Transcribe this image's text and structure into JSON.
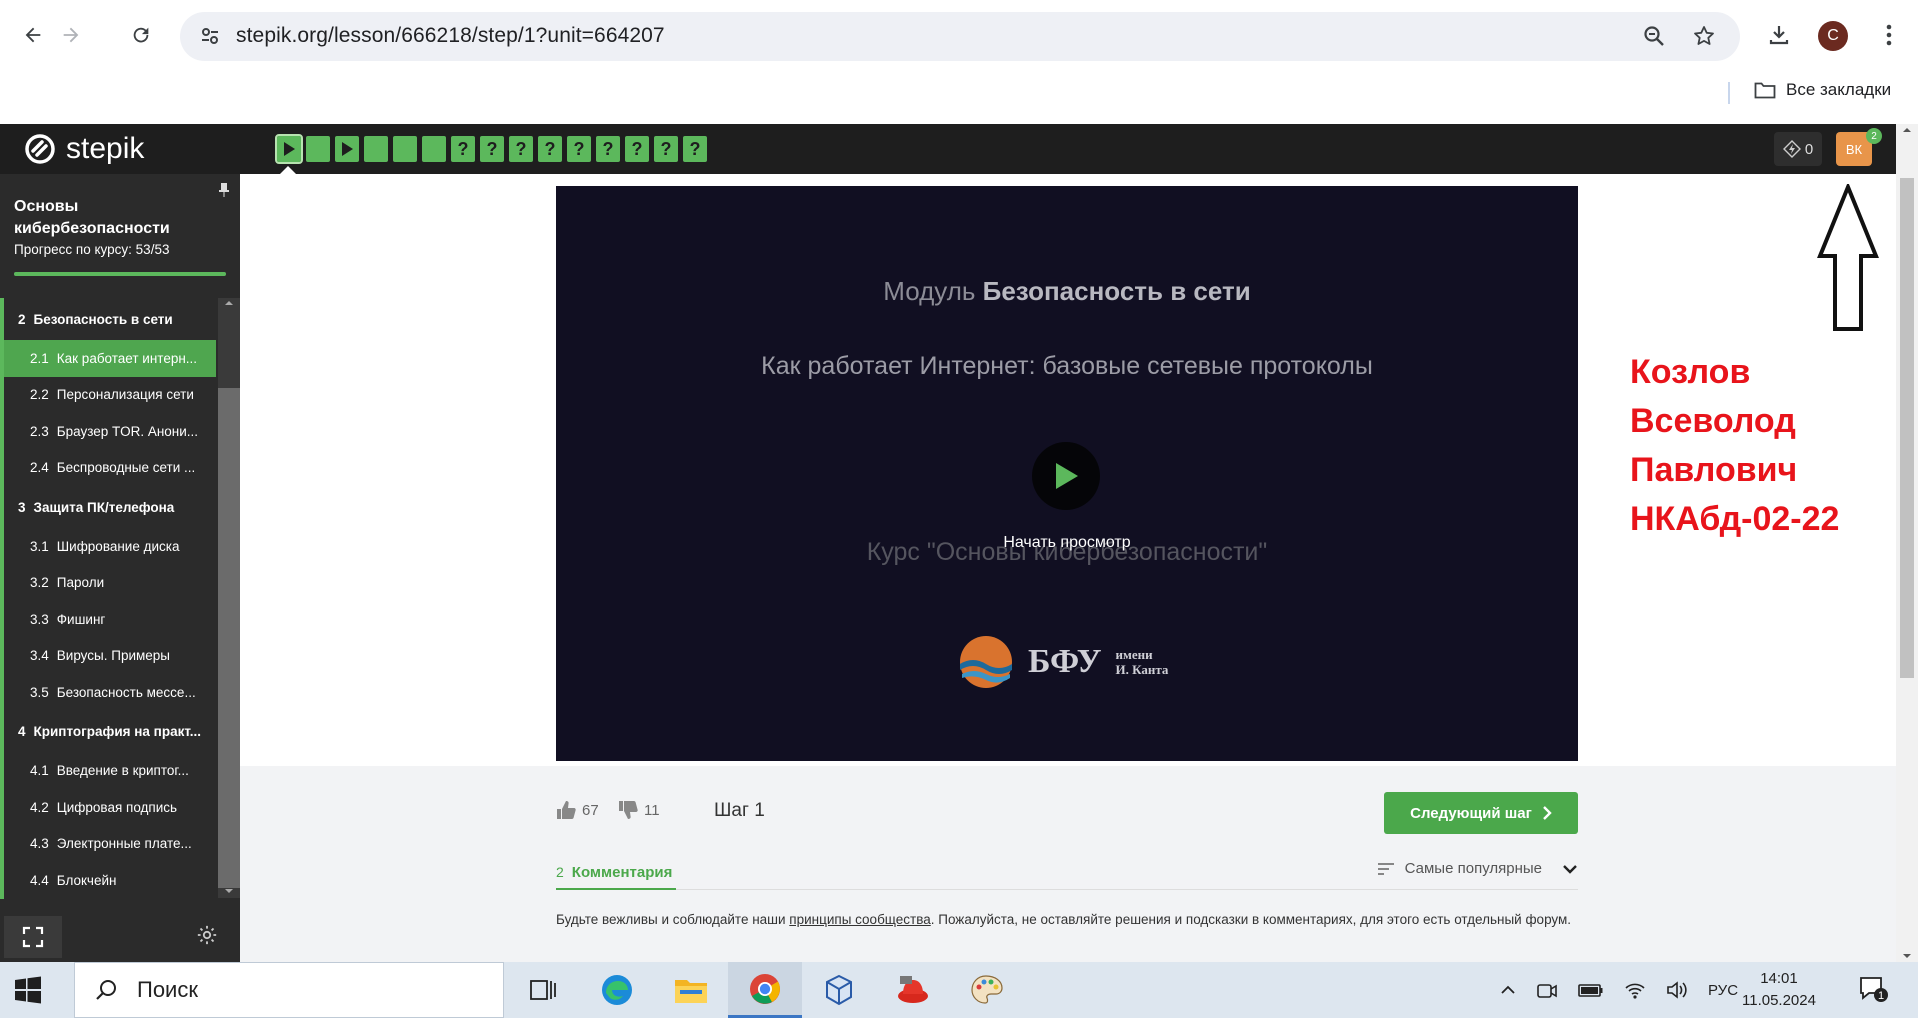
{
  "browser": {
    "url": "stepik.org/lesson/666218/step/1?unit=664207",
    "profile_initial": "C",
    "bookmarks_label": "Все закладки"
  },
  "header": {
    "logo_text": "stepik",
    "steps": [
      "video",
      "done",
      "video",
      "done",
      "done",
      "done",
      "?",
      "?",
      "?",
      "?",
      "?",
      "?",
      "?",
      "?",
      "?"
    ],
    "energy": "0",
    "user_initials": "ВК",
    "notifications": "2"
  },
  "sidebar": {
    "course_title": "Основы кибербезопасности",
    "progress_label": "Прогресс по курсу:",
    "progress_value": "53/53",
    "progress_fraction": 1.0,
    "sections": [
      {
        "num": "2",
        "title": "Безопасность в сети",
        "lessons": [
          {
            "num": "2.1",
            "title": "Как работает интерн...",
            "active": true
          },
          {
            "num": "2.2",
            "title": "Персонализация сети"
          },
          {
            "num": "2.3",
            "title": "Браузер TOR. Анони..."
          },
          {
            "num": "2.4",
            "title": "Беспроводные сети ..."
          }
        ]
      },
      {
        "num": "3",
        "title": "Защита ПК/телефона",
        "lessons": [
          {
            "num": "3.1",
            "title": "Шифрование диска"
          },
          {
            "num": "3.2",
            "title": "Пароли"
          },
          {
            "num": "3.3",
            "title": "Фишинг"
          },
          {
            "num": "3.4",
            "title": "Вирусы. Примеры"
          },
          {
            "num": "3.5",
            "title": "Безопасность мессе..."
          }
        ]
      },
      {
        "num": "4",
        "title": "Криптография на практ...",
        "lessons": [
          {
            "num": "4.1",
            "title": "Введение в криптог..."
          },
          {
            "num": "4.2",
            "title": "Цифровая подпись"
          },
          {
            "num": "4.3",
            "title": "Электронные плате..."
          },
          {
            "num": "4.4",
            "title": "Блокчейн"
          }
        ]
      }
    ]
  },
  "video": {
    "module_prefix": "Модуль",
    "module_name": "Безопасность в сети",
    "lesson_title": "Как работает Интернет: базовые сетевые протоколы",
    "start_label": "Начать просмотр",
    "course_line": "Курс \"Основы кибербезопасности\"",
    "logo_big": "БФУ",
    "logo_small_1": "имени",
    "logo_small_2": "И. Канта"
  },
  "step": {
    "likes": "67",
    "dislikes": "11",
    "step_label": "Шаг 1",
    "next_label": "Следующий шаг"
  },
  "comments": {
    "count": "2",
    "tab_label": "Комментария",
    "sort_label": "Самые популярные",
    "rules_before": "Будьте вежливы и соблюдайте наши ",
    "rules_link": "принципы сообщества",
    "rules_after": ". Пожалуйста, не оставляйте решения и подсказки в комментариях, для этого есть отдельный форум."
  },
  "annotation": {
    "name_lines": [
      "Козлов",
      "Всеволод",
      "Павлович",
      "НКАбд-02-22"
    ],
    "color": "#e8141b"
  },
  "taskbar": {
    "search_placeholder": "Поиск",
    "language": "РУС",
    "time": "14:01",
    "date": "11.05.2024",
    "notif_count": "1"
  }
}
